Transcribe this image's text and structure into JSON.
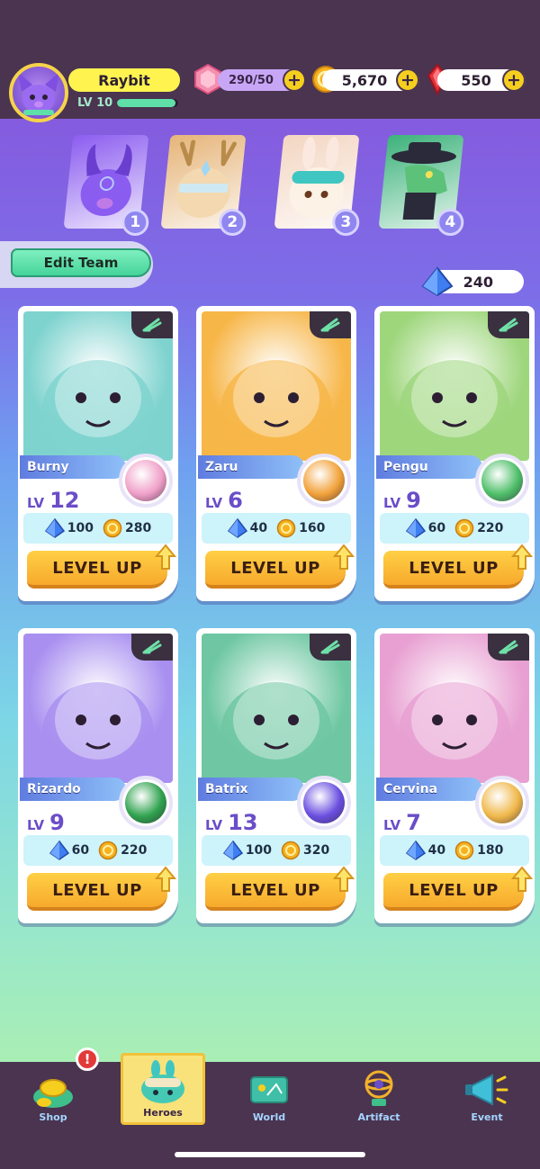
{
  "player": {
    "name": "Raybit",
    "level_label": "LV 10",
    "xp_progress": 0.95
  },
  "resources": {
    "energy": "290/50",
    "coins": "5,670",
    "gems": "550",
    "crystals": "240",
    "plus": "+"
  },
  "team": {
    "slots": [
      {
        "num": "1",
        "color": "#8b5cf0"
      },
      {
        "num": "2",
        "color": "#e6b57a"
      },
      {
        "num": "3",
        "color": "#f3d6c2"
      },
      {
        "num": "4",
        "color": "#3bb27a"
      }
    ],
    "edit_label": "Edit Team"
  },
  "heroes": [
    {
      "name": "Burny",
      "lv_label": "LV",
      "lv": "12",
      "crystal_cost": "100",
      "coin_cost": "280",
      "button": "LEVEL UP",
      "bg": "#7fd3cf",
      "orb": "#f0a0c8"
    },
    {
      "name": "Zaru",
      "lv_label": "LV",
      "lv": "6",
      "crystal_cost": "40",
      "coin_cost": "160",
      "button": "LEVEL UP",
      "bg": "#f7b648",
      "orb": "#f2a23a"
    },
    {
      "name": "Pengu",
      "lv_label": "LV",
      "lv": "9",
      "crystal_cost": "60",
      "coin_cost": "220",
      "button": "LEVEL UP",
      "bg": "#9ed67c",
      "orb": "#4fbf6a"
    },
    {
      "name": "Rizardo",
      "lv_label": "LV",
      "lv": "9",
      "crystal_cost": "60",
      "coin_cost": "220",
      "button": "LEVEL UP",
      "bg": "#a88ff0",
      "orb": "#2fa24e"
    },
    {
      "name": "Batrix",
      "lv_label": "LV",
      "lv": "13",
      "crystal_cost": "100",
      "coin_cost": "320",
      "button": "LEVEL UP",
      "bg": "#6ec7a2",
      "orb": "#6a4fe0"
    },
    {
      "name": "Cervina",
      "lv_label": "LV",
      "lv": "7",
      "crystal_cost": "40",
      "coin_cost": "180",
      "button": "LEVEL UP",
      "bg": "#e8a0d2",
      "orb": "#f0b84a"
    }
  ],
  "nav": {
    "items": [
      {
        "label": "Shop",
        "icon": "coin-bag-icon"
      },
      {
        "label": "Heroes",
        "icon": "hero-head-icon"
      },
      {
        "label": "World",
        "icon": "map-icon"
      },
      {
        "label": "Artifact",
        "icon": "armillary-icon"
      },
      {
        "label": "Event",
        "icon": "megaphone-icon"
      }
    ],
    "shop_badge": "!"
  },
  "colors": {
    "accent_yellow": "#f6cf1e",
    "panel_dark": "#4a3450",
    "level_text": "#6a4dc8",
    "edit_team_green": "#45d49a"
  }
}
